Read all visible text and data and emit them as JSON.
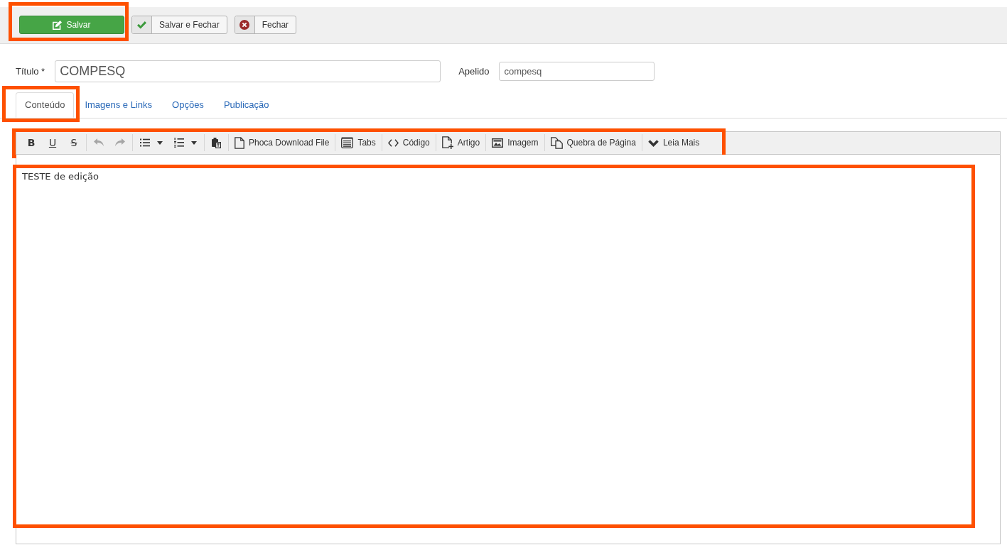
{
  "actions": [
    {
      "kind": "save",
      "label": "Salvar",
      "highlighted": true
    },
    {
      "kind": "save-close",
      "label": "Salvar e Fechar",
      "highlighted": false
    },
    {
      "kind": "close",
      "label": "Fechar",
      "highlighted": false
    }
  ],
  "fields": [
    {
      "kind": "title",
      "label": "Título *",
      "value": "COMPESQ"
    },
    {
      "kind": "alias",
      "label": "Apelido",
      "value": "compesq"
    }
  ],
  "tabs": [
    {
      "label": "Conteúdo",
      "selected": true,
      "highlighted": true
    },
    {
      "label": "Imagens e Links",
      "selected": false,
      "highlighted": false
    },
    {
      "label": "Opções",
      "selected": false,
      "highlighted": false
    },
    {
      "label": "Publicação",
      "selected": false,
      "highlighted": false
    }
  ],
  "editor": {
    "toolbar": {
      "highlighted": true,
      "groups": [
        {
          "items": [
            {
              "kind": "bold",
              "label": "B",
              "disabled": false
            },
            {
              "kind": "underline",
              "label": "U",
              "disabled": false
            },
            {
              "kind": "strike",
              "label": "S",
              "disabled": false
            }
          ]
        },
        {
          "items": [
            {
              "kind": "undo",
              "disabled": true
            },
            {
              "kind": "redo",
              "disabled": true
            }
          ]
        },
        {
          "items": [
            {
              "kind": "bullets",
              "disabled": false
            },
            {
              "kind": "numbers",
              "disabled": false
            }
          ]
        },
        {
          "items": [
            {
              "kind": "paste",
              "disabled": false
            }
          ]
        },
        {
          "items": [
            {
              "kind": "file",
              "label": "Phoca Download File",
              "disabled": false
            }
          ]
        },
        {
          "items": [
            {
              "kind": "tabs",
              "label": "Tabs",
              "disabled": false
            }
          ]
        },
        {
          "items": [
            {
              "kind": "code",
              "label": "Código",
              "disabled": false
            }
          ]
        },
        {
          "items": [
            {
              "kind": "article",
              "label": "Artigo",
              "disabled": false
            }
          ]
        },
        {
          "items": [
            {
              "kind": "image",
              "label": "Imagem",
              "disabled": false
            }
          ]
        },
        {
          "items": [
            {
              "kind": "pagebreak",
              "label": "Quebra de Página",
              "disabled": false
            }
          ]
        },
        {
          "items": [
            {
              "kind": "readmore",
              "label": "Leia Mais",
              "disabled": false
            }
          ]
        }
      ]
    },
    "content": "TESTE de edição",
    "highlighted": true
  }
}
